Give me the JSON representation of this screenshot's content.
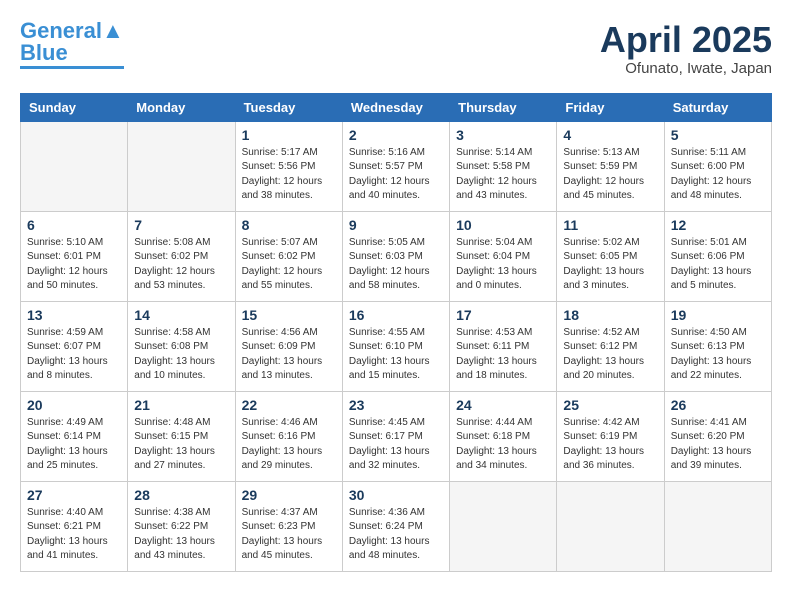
{
  "header": {
    "logo_line1": "General",
    "logo_line2": "Blue",
    "month_year": "April 2025",
    "location": "Ofunato, Iwate, Japan"
  },
  "days_of_week": [
    "Sunday",
    "Monday",
    "Tuesday",
    "Wednesday",
    "Thursday",
    "Friday",
    "Saturday"
  ],
  "weeks": [
    [
      {
        "day": "",
        "info": ""
      },
      {
        "day": "",
        "info": ""
      },
      {
        "day": "1",
        "info": "Sunrise: 5:17 AM\nSunset: 5:56 PM\nDaylight: 12 hours\nand 38 minutes."
      },
      {
        "day": "2",
        "info": "Sunrise: 5:16 AM\nSunset: 5:57 PM\nDaylight: 12 hours\nand 40 minutes."
      },
      {
        "day": "3",
        "info": "Sunrise: 5:14 AM\nSunset: 5:58 PM\nDaylight: 12 hours\nand 43 minutes."
      },
      {
        "day": "4",
        "info": "Sunrise: 5:13 AM\nSunset: 5:59 PM\nDaylight: 12 hours\nand 45 minutes."
      },
      {
        "day": "5",
        "info": "Sunrise: 5:11 AM\nSunset: 6:00 PM\nDaylight: 12 hours\nand 48 minutes."
      }
    ],
    [
      {
        "day": "6",
        "info": "Sunrise: 5:10 AM\nSunset: 6:01 PM\nDaylight: 12 hours\nand 50 minutes."
      },
      {
        "day": "7",
        "info": "Sunrise: 5:08 AM\nSunset: 6:02 PM\nDaylight: 12 hours\nand 53 minutes."
      },
      {
        "day": "8",
        "info": "Sunrise: 5:07 AM\nSunset: 6:02 PM\nDaylight: 12 hours\nand 55 minutes."
      },
      {
        "day": "9",
        "info": "Sunrise: 5:05 AM\nSunset: 6:03 PM\nDaylight: 12 hours\nand 58 minutes."
      },
      {
        "day": "10",
        "info": "Sunrise: 5:04 AM\nSunset: 6:04 PM\nDaylight: 13 hours\nand 0 minutes."
      },
      {
        "day": "11",
        "info": "Sunrise: 5:02 AM\nSunset: 6:05 PM\nDaylight: 13 hours\nand 3 minutes."
      },
      {
        "day": "12",
        "info": "Sunrise: 5:01 AM\nSunset: 6:06 PM\nDaylight: 13 hours\nand 5 minutes."
      }
    ],
    [
      {
        "day": "13",
        "info": "Sunrise: 4:59 AM\nSunset: 6:07 PM\nDaylight: 13 hours\nand 8 minutes."
      },
      {
        "day": "14",
        "info": "Sunrise: 4:58 AM\nSunset: 6:08 PM\nDaylight: 13 hours\nand 10 minutes."
      },
      {
        "day": "15",
        "info": "Sunrise: 4:56 AM\nSunset: 6:09 PM\nDaylight: 13 hours\nand 13 minutes."
      },
      {
        "day": "16",
        "info": "Sunrise: 4:55 AM\nSunset: 6:10 PM\nDaylight: 13 hours\nand 15 minutes."
      },
      {
        "day": "17",
        "info": "Sunrise: 4:53 AM\nSunset: 6:11 PM\nDaylight: 13 hours\nand 18 minutes."
      },
      {
        "day": "18",
        "info": "Sunrise: 4:52 AM\nSunset: 6:12 PM\nDaylight: 13 hours\nand 20 minutes."
      },
      {
        "day": "19",
        "info": "Sunrise: 4:50 AM\nSunset: 6:13 PM\nDaylight: 13 hours\nand 22 minutes."
      }
    ],
    [
      {
        "day": "20",
        "info": "Sunrise: 4:49 AM\nSunset: 6:14 PM\nDaylight: 13 hours\nand 25 minutes."
      },
      {
        "day": "21",
        "info": "Sunrise: 4:48 AM\nSunset: 6:15 PM\nDaylight: 13 hours\nand 27 minutes."
      },
      {
        "day": "22",
        "info": "Sunrise: 4:46 AM\nSunset: 6:16 PM\nDaylight: 13 hours\nand 29 minutes."
      },
      {
        "day": "23",
        "info": "Sunrise: 4:45 AM\nSunset: 6:17 PM\nDaylight: 13 hours\nand 32 minutes."
      },
      {
        "day": "24",
        "info": "Sunrise: 4:44 AM\nSunset: 6:18 PM\nDaylight: 13 hours\nand 34 minutes."
      },
      {
        "day": "25",
        "info": "Sunrise: 4:42 AM\nSunset: 6:19 PM\nDaylight: 13 hours\nand 36 minutes."
      },
      {
        "day": "26",
        "info": "Sunrise: 4:41 AM\nSunset: 6:20 PM\nDaylight: 13 hours\nand 39 minutes."
      }
    ],
    [
      {
        "day": "27",
        "info": "Sunrise: 4:40 AM\nSunset: 6:21 PM\nDaylight: 13 hours\nand 41 minutes."
      },
      {
        "day": "28",
        "info": "Sunrise: 4:38 AM\nSunset: 6:22 PM\nDaylight: 13 hours\nand 43 minutes."
      },
      {
        "day": "29",
        "info": "Sunrise: 4:37 AM\nSunset: 6:23 PM\nDaylight: 13 hours\nand 45 minutes."
      },
      {
        "day": "30",
        "info": "Sunrise: 4:36 AM\nSunset: 6:24 PM\nDaylight: 13 hours\nand 48 minutes."
      },
      {
        "day": "",
        "info": ""
      },
      {
        "day": "",
        "info": ""
      },
      {
        "day": "",
        "info": ""
      }
    ]
  ]
}
